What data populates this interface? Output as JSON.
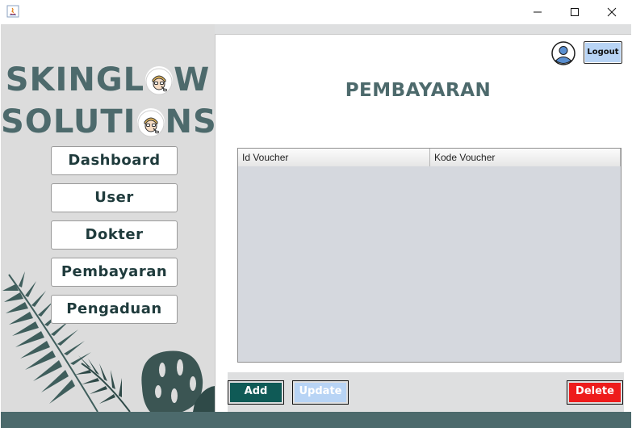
{
  "brand": {
    "line1_before": "SKINGL",
    "line1_after": "W",
    "line2_before": "SOLUTI",
    "line2_after": "NS"
  },
  "sidebar": {
    "items": [
      {
        "label": "Dashboard"
      },
      {
        "label": "User"
      },
      {
        "label": "Dokter"
      },
      {
        "label": "Pembayaran"
      },
      {
        "label": "Pengaduan"
      }
    ]
  },
  "header": {
    "logout_label": "Logout",
    "page_title": "PEMBAYARAN"
  },
  "table": {
    "columns": [
      "Id Voucher",
      "Kode Voucher"
    ],
    "rows": []
  },
  "actions": {
    "add_label": "Add",
    "update_label": "Update",
    "delete_label": "Delete"
  },
  "colors": {
    "brand": "#4d6a6c",
    "add": "#0f5a56",
    "update": "#b8d4f5",
    "delete": "#ee1c1c",
    "strip": "#4c6a6c"
  }
}
